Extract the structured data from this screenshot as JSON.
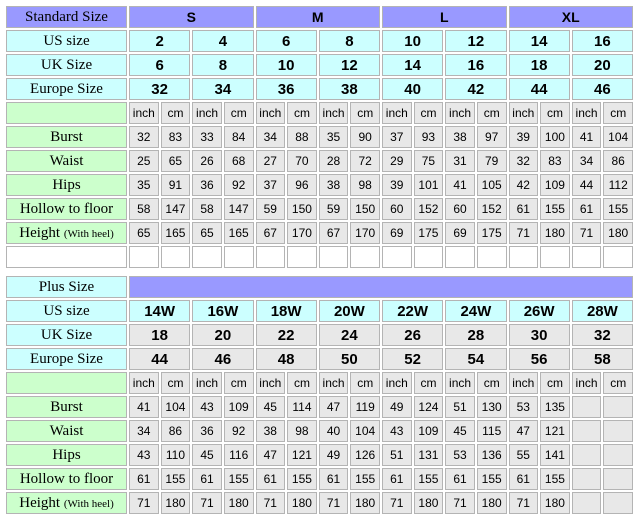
{
  "standard": {
    "title": "Standard Size",
    "sizes": [
      "S",
      "M",
      "L",
      "XL"
    ],
    "us_label": "US size",
    "us": [
      "2",
      "4",
      "6",
      "8",
      "10",
      "12",
      "14",
      "16"
    ],
    "uk_label": "UK Size",
    "uk": [
      "6",
      "8",
      "10",
      "12",
      "14",
      "16",
      "18",
      "20"
    ],
    "eu_label": "Europe Size",
    "eu": [
      "32",
      "34",
      "36",
      "38",
      "40",
      "42",
      "44",
      "46"
    ],
    "units": [
      "inch",
      "cm",
      "inch",
      "cm",
      "inch",
      "cm",
      "inch",
      "cm",
      "inch",
      "cm",
      "inch",
      "cm",
      "inch",
      "cm",
      "inch",
      "cm"
    ],
    "rows": [
      {
        "label": "Burst",
        "values": [
          "32",
          "83",
          "33",
          "84",
          "34",
          "88",
          "35",
          "90",
          "37",
          "93",
          "38",
          "97",
          "39",
          "100",
          "41",
          "104"
        ]
      },
      {
        "label": "Waist",
        "values": [
          "25",
          "65",
          "26",
          "68",
          "27",
          "70",
          "28",
          "72",
          "29",
          "75",
          "31",
          "79",
          "32",
          "83",
          "34",
          "86"
        ]
      },
      {
        "label": "Hips",
        "values": [
          "35",
          "91",
          "36",
          "92",
          "37",
          "96",
          "38",
          "98",
          "39",
          "101",
          "41",
          "105",
          "42",
          "109",
          "44",
          "112"
        ]
      },
      {
        "label": "Hollow to floor",
        "values": [
          "58",
          "147",
          "58",
          "147",
          "59",
          "150",
          "59",
          "150",
          "60",
          "152",
          "60",
          "152",
          "61",
          "155",
          "61",
          "155"
        ]
      }
    ],
    "height": {
      "label": "Height",
      "note": "(With heel)",
      "values": [
        "65",
        "165",
        "65",
        "165",
        "67",
        "170",
        "67",
        "170",
        "69",
        "175",
        "69",
        "175",
        "71",
        "180",
        "71",
        "180"
      ]
    }
  },
  "plus": {
    "title": "Plus Size",
    "us_label": "US size",
    "us": [
      "14W",
      "16W",
      "18W",
      "20W",
      "22W",
      "24W",
      "26W",
      "28W"
    ],
    "uk_label": "UK Size",
    "uk": [
      "18",
      "20",
      "22",
      "24",
      "26",
      "28",
      "30",
      "32"
    ],
    "eu_label": "Europe Size",
    "eu": [
      "44",
      "46",
      "48",
      "50",
      "52",
      "54",
      "56",
      "58"
    ],
    "units": [
      "inch",
      "cm",
      "inch",
      "cm",
      "inch",
      "cm",
      "inch",
      "cm",
      "inch",
      "cm",
      "inch",
      "cm",
      "inch",
      "cm",
      "inch",
      "cm"
    ],
    "rows": [
      {
        "label": "Burst",
        "values": [
          "41",
          "104",
          "43",
          "109",
          "45",
          "114",
          "47",
          "119",
          "49",
          "124",
          "51",
          "130",
          "53",
          "135",
          "",
          ""
        ]
      },
      {
        "label": "Waist",
        "values": [
          "34",
          "86",
          "36",
          "92",
          "38",
          "98",
          "40",
          "104",
          "43",
          "109",
          "45",
          "115",
          "47",
          "121",
          "",
          ""
        ]
      },
      {
        "label": "Hips",
        "values": [
          "43",
          "110",
          "45",
          "116",
          "47",
          "121",
          "49",
          "126",
          "51",
          "131",
          "53",
          "136",
          "55",
          "141",
          "",
          ""
        ]
      },
      {
        "label": "Hollow to floor",
        "values": [
          "61",
          "155",
          "61",
          "155",
          "61",
          "155",
          "61",
          "155",
          "61",
          "155",
          "61",
          "155",
          "61",
          "155",
          "",
          ""
        ]
      }
    ],
    "height": {
      "label": "Height",
      "note": "(With heel)",
      "values": [
        "71",
        "180",
        "71",
        "180",
        "71",
        "180",
        "71",
        "180",
        "71",
        "180",
        "71",
        "180",
        "71",
        "180",
        "",
        ""
      ]
    }
  }
}
